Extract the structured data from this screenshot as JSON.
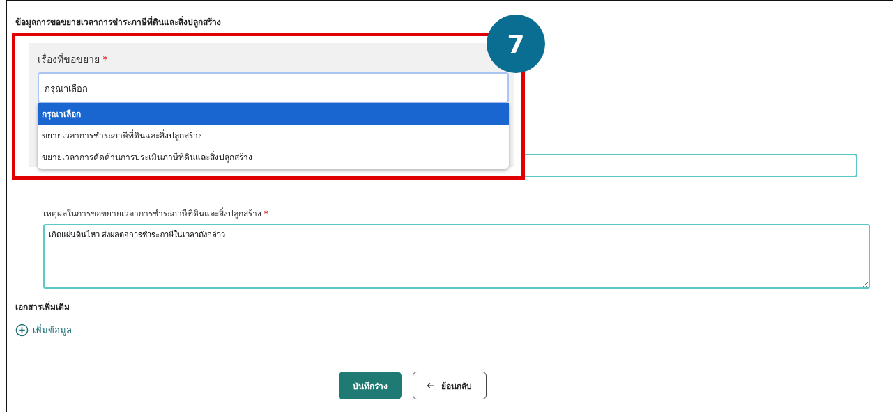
{
  "section_title": "ข้อมูลการขอขยายเวลาการชำระภาษีที่ดินและสิ่งปลูกสร้าง",
  "step_badge": "7",
  "subject_field": {
    "label": "เรื่องที่ขอขยาย",
    "required_mark": "*",
    "value": "กรุณาเลือก",
    "options": [
      {
        "label": "กรุณาเลือก",
        "selected": true
      },
      {
        "label": "ขยายเวลาการชำระภาษีที่ดินและสิ่งปลูกสร้าง",
        "selected": false
      },
      {
        "label": "ขยายเวลาการคัดค้านการประเมินภาษีที่ดินและสิ่งปลูกสร้าง",
        "selected": false
      }
    ]
  },
  "reason_field": {
    "label": "เหตุผลในการขอขยายเวลาการชำระภาษีที่ดินและสิ่งปลูกสร้าง",
    "required_mark": "*",
    "value": "เกิดแผ่นดินไหว ส่งผลต่อการชำระภาษีในเวลาดังกล่าว"
  },
  "documents": {
    "title": "เอกสารเพิ่มเติม",
    "add_link": "เพิ่มข้อมูล"
  },
  "buttons": [
    {
      "kind": "primary",
      "label": "บันทึกร่าง"
    },
    {
      "kind": "back",
      "label": "ย้อนกลับ"
    }
  ]
}
